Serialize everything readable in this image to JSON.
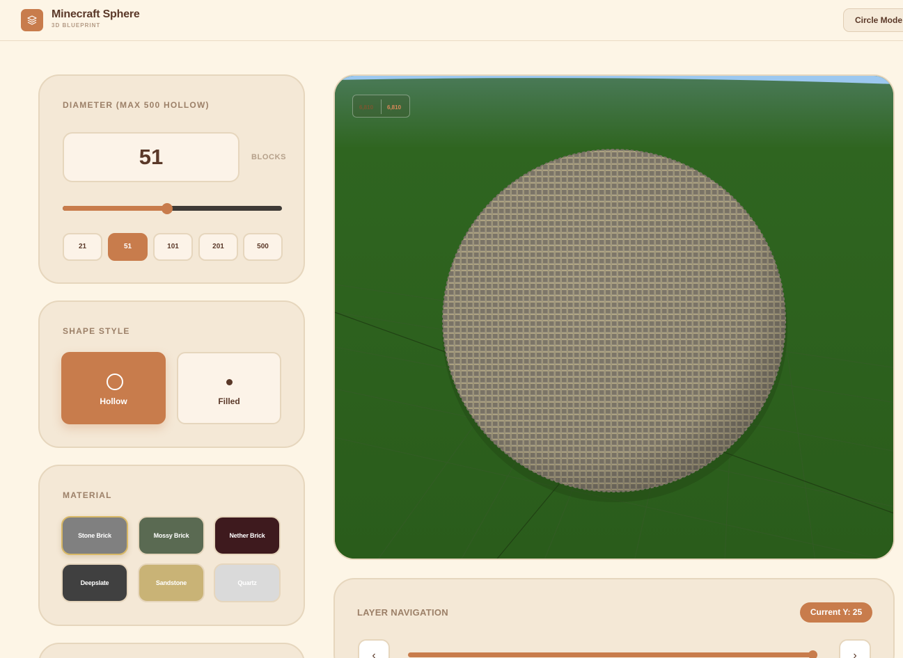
{
  "header": {
    "title": "Minecraft Sphere",
    "subtitle": "3D BLUEPRINT",
    "mode_button": "Circle Mode",
    "logo_icon": "layers-icon"
  },
  "diameter": {
    "label": "DIAMETER (MAX 500 HOLLOW)",
    "value": "51",
    "unit": "BLOCKS",
    "slider": {
      "min": 1,
      "max": 500,
      "value": 51
    },
    "presets": [
      {
        "label": "21",
        "active": false
      },
      {
        "label": "51",
        "active": true
      },
      {
        "label": "101",
        "active": false
      },
      {
        "label": "201",
        "active": false
      },
      {
        "label": "500",
        "active": false
      }
    ]
  },
  "shape_style": {
    "label": "SHAPE STYLE",
    "options": [
      {
        "label": "Hollow",
        "icon": "hollow-circle-icon",
        "active": true
      },
      {
        "label": "Filled",
        "icon": "filled-dot-icon",
        "active": false
      }
    ]
  },
  "material": {
    "label": "MATERIAL",
    "options": [
      {
        "label": "Stone Brick",
        "color": "#808080",
        "selected": true
      },
      {
        "label": "Mossy Brick",
        "color": "#5a6a52",
        "selected": false
      },
      {
        "label": "Nether Brick",
        "color": "#3e1a1e",
        "selected": false
      },
      {
        "label": "Deepslate",
        "color": "#404040",
        "selected": false
      },
      {
        "label": "Sandstone",
        "color": "#c9b376",
        "selected": false
      },
      {
        "label": "Quartz",
        "color": "#dadada",
        "selected": false
      }
    ]
  },
  "viewport": {
    "block_count_a": "6,810",
    "block_count_b": "6,810",
    "ground_color": "#2b5f1c",
    "sky_color": "#9cc8f0",
    "block_color": "#8a8474"
  },
  "layer_nav": {
    "title": "LAYER NAVIGATION",
    "current": "Current Y: 25",
    "prev_icon": "‹",
    "next_icon": "›",
    "progress": 1.0
  },
  "colors": {
    "accent": "#c87c4c",
    "background": "#fdf5e6",
    "card": "#f4e8d6",
    "text": "#5a3828"
  }
}
